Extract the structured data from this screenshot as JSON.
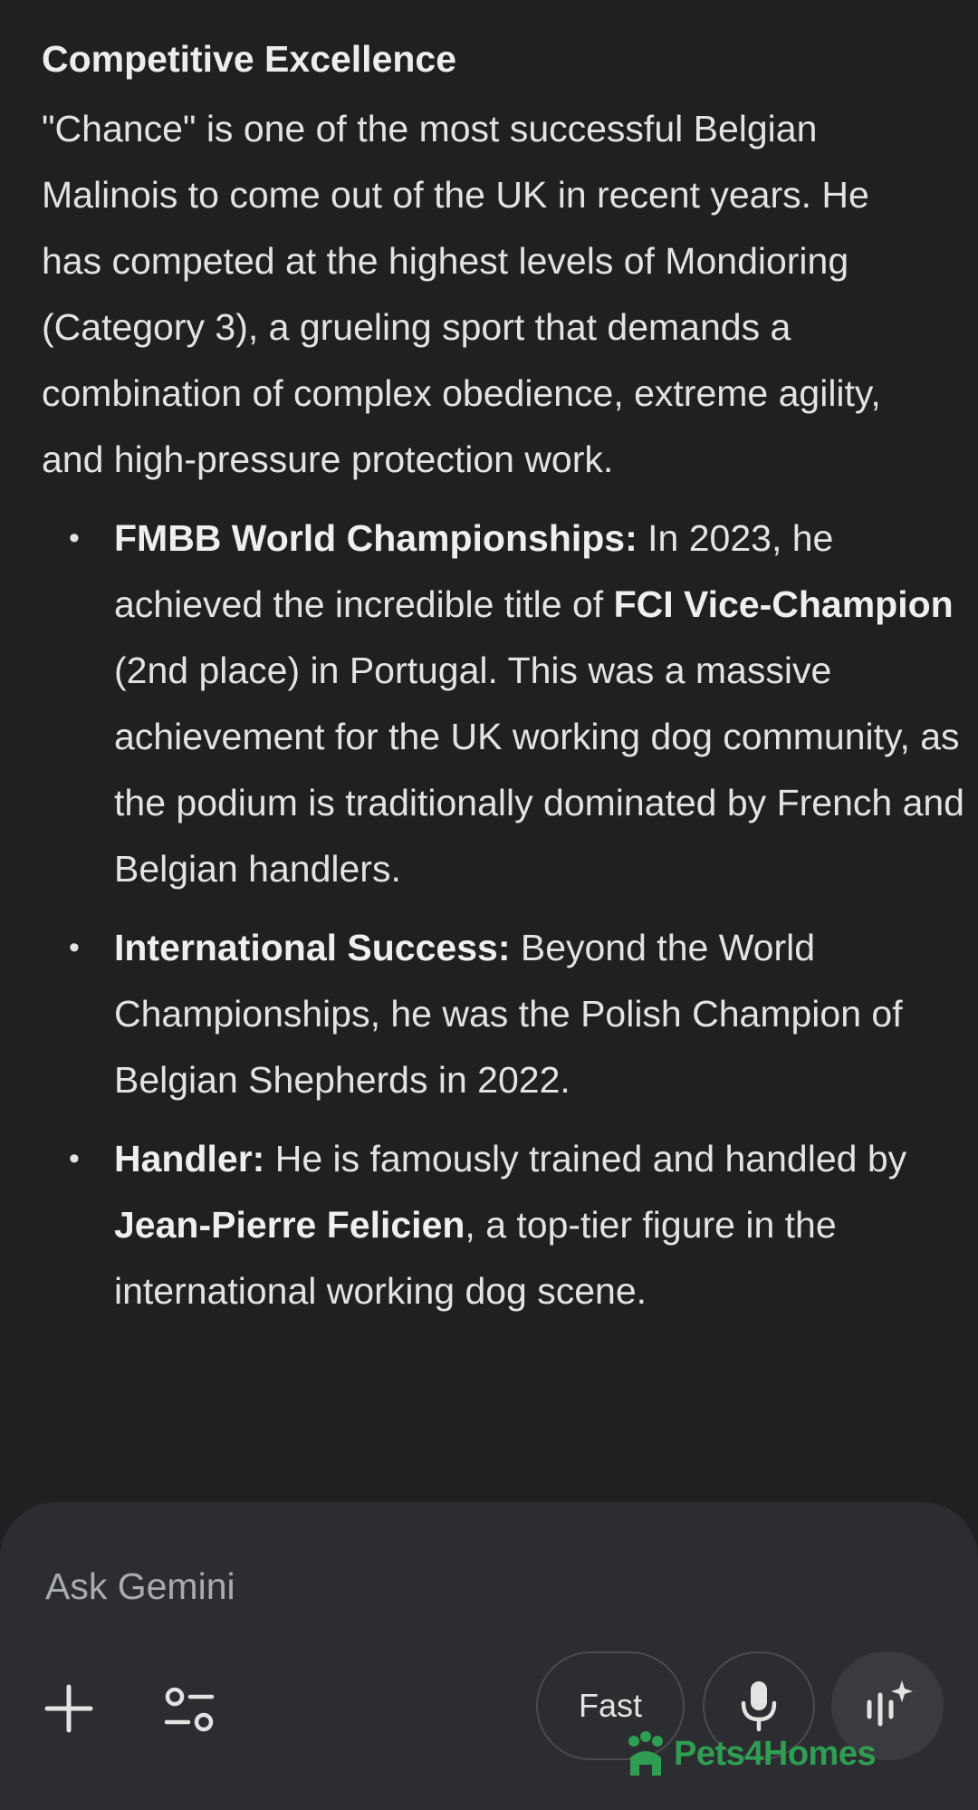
{
  "article": {
    "heading": "Competitive Excellence",
    "intro": "\"Chance\" is one of the most successful Belgian Malinois to come out of the UK in recent years. He has competed at the highest levels of Mondioring (Category 3), a grueling sport that demands a combination of complex obedience, extreme agility, and high-pressure protection work.",
    "bullets": [
      {
        "label": "FMBB World Championships:",
        "text_before": " In 2023, he achieved the incredible title of ",
        "bold_mid": "FCI Vice-Champion",
        "text_after": " (2nd place) in Portugal. This was a massive achievement for the UK working dog community, as the podium is traditionally dominated by French and Belgian handlers."
      },
      {
        "label": "International Success:",
        "text": " Beyond the World Championships, he was the Polish Champion of Belgian Shepherds in 2022."
      },
      {
        "label": "Handler:",
        "text_before": " He is famously trained and handled by ",
        "bold_mid": "Jean-Pierre Felicien",
        "text_after": ", a top-tier figure in the international working dog scene."
      }
    ]
  },
  "composer": {
    "placeholder": "Ask Gemini",
    "add_icon": "plus-icon",
    "tools_icon": "tools-sliders-icon",
    "model_label": "Fast",
    "mic_icon": "microphone-icon",
    "live_icon": "live-sparkle-icon"
  },
  "watermark": {
    "text": "Pets4Homes",
    "color": "#2f9e52"
  }
}
